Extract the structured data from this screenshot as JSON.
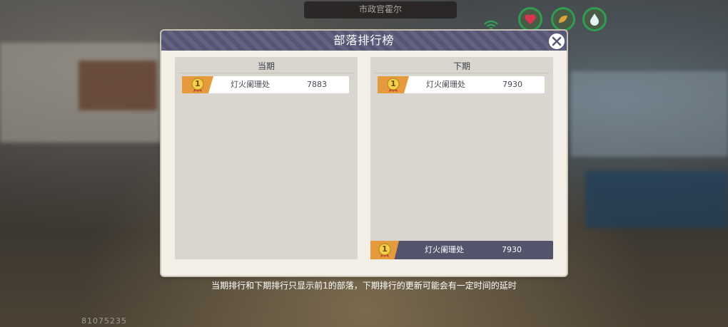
{
  "hud": {
    "top_label": "市政官霍尔",
    "player_id": "81075235",
    "status_icons": [
      "wifi-icon",
      "heart-icon",
      "food-icon",
      "water-drop-icon"
    ]
  },
  "dialog": {
    "title": "部落排行榜",
    "close_icon": "close-icon",
    "current_panel": {
      "title": "当期",
      "rows": [
        {
          "rank": "1",
          "name": "灯火阑珊处",
          "score": "7883"
        }
      ]
    },
    "next_panel": {
      "title": "下期",
      "rows": [
        {
          "rank": "1",
          "name": "灯火阑珊处",
          "score": "7930"
        }
      ]
    },
    "self_row": {
      "rank": "1",
      "name": "灯火阑珊处",
      "score": "7930"
    },
    "footer_note": "当期排行和下期排行只显示前1的部落，下期排行的更新可能会有一定时间的延时"
  },
  "colors": {
    "header": "#5b5a79",
    "badge": "#e59a3e",
    "panel": "#d8d6ce",
    "status_ring": "#2f9d52",
    "heart": "#d8344b"
  }
}
